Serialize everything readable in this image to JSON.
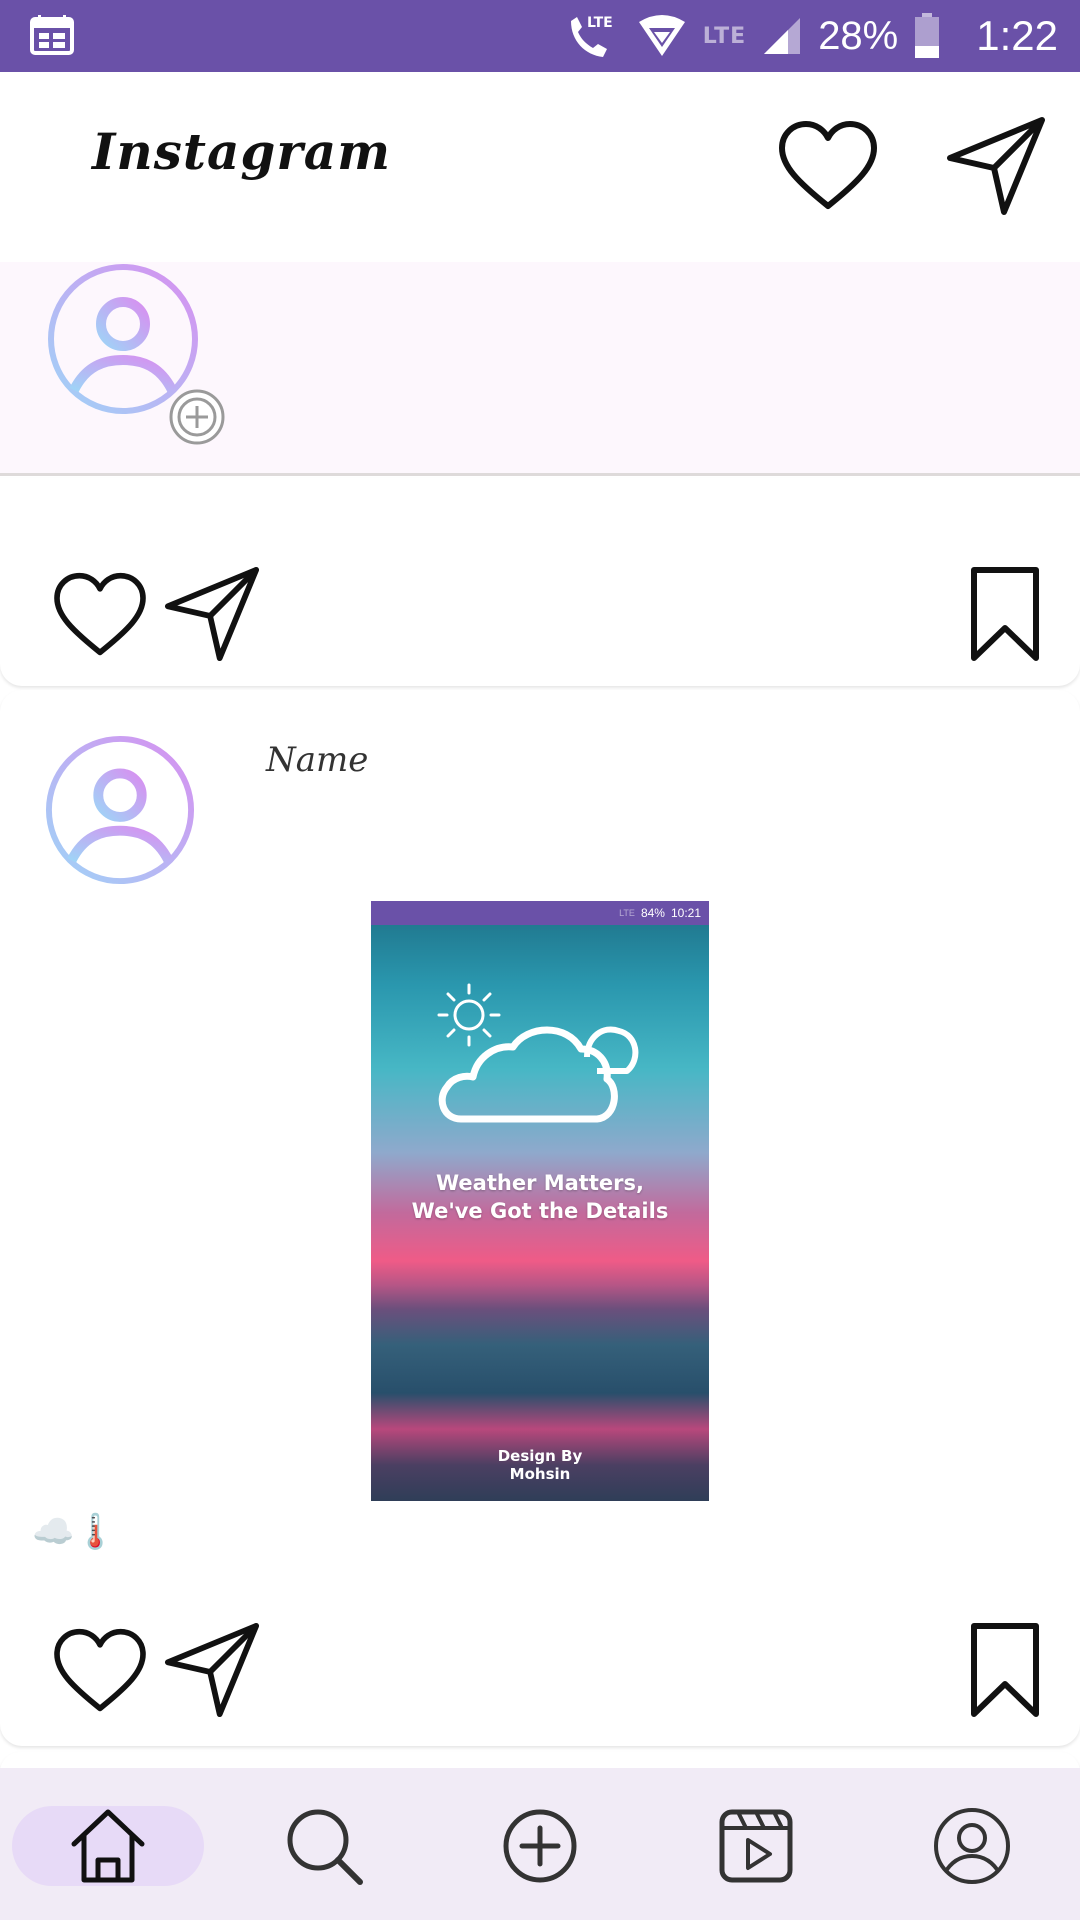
{
  "status_bar": {
    "network_label": "LTE",
    "battery": "28%",
    "time": "1:22",
    "icons": [
      "calendar-icon",
      "volte-call-icon",
      "wifi-icon",
      "signal-icon",
      "battery-icon"
    ]
  },
  "app_bar": {
    "title": "Instagram",
    "icons": [
      "heart-icon",
      "send-icon"
    ]
  },
  "stories": {
    "items": [
      {
        "icon": "user-avatar-icon",
        "badge": "add-story-icon"
      }
    ]
  },
  "posts": [
    {
      "actions": [
        "heart-icon",
        "send-icon",
        "bookmark-icon"
      ]
    },
    {
      "user_name": "Name",
      "image": {
        "status": {
          "battery": "84%",
          "time": "10:21",
          "network": "LTE"
        },
        "headline_line1": "Weather Matters,",
        "headline_line2": "We've Got the Details",
        "credit_line1": "Design By",
        "credit_line2": "Mohsin"
      },
      "caption": "☁️🌡️",
      "actions": [
        "heart-icon",
        "send-icon",
        "bookmark-icon"
      ]
    }
  ],
  "bottom_nav": {
    "items": [
      "home-icon",
      "search-icon",
      "add-post-icon",
      "reels-icon",
      "profile-icon"
    ],
    "selected": "home-icon"
  },
  "colors": {
    "status_bar": "#6a51a8",
    "stories_bg": "#fdf7fd",
    "bottom_nav_bg": "#f1ebf6",
    "nav_selected": "#e7daf7",
    "avatar_gradient_start": "#9fd4f7",
    "avatar_gradient_end": "#d88ff0"
  }
}
